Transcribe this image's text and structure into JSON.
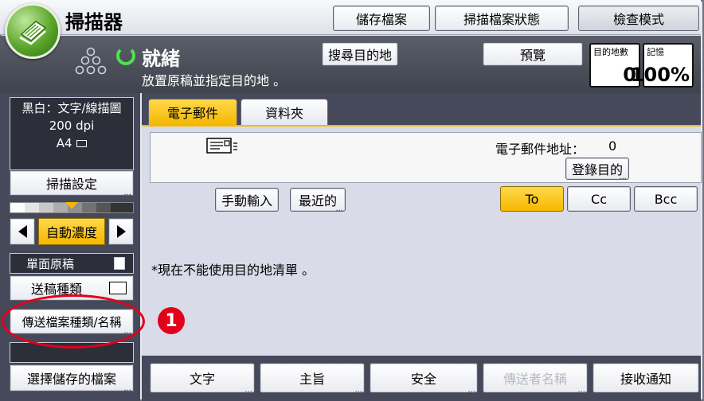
{
  "app": {
    "title": "掃描器"
  },
  "header_buttons": {
    "store_file": "儲存檔案",
    "scanned_files_status": "掃描檔案狀態",
    "check_mode": "檢查模式"
  },
  "status": {
    "title": "就緒",
    "message": "放置原稿並指定目的地 。",
    "search_destination": "搜尋目的地",
    "preview": "預覽"
  },
  "counters": {
    "destinations_label": "目的地數",
    "destinations_value": "0",
    "memory_label": "記憶",
    "memory_value": "100%"
  },
  "sidebar": {
    "info_lines": [
      "黑白：文字/線描圖",
      "200 dpi",
      "A4"
    ],
    "scan_settings": "掃描設定",
    "density_label": "自動濃度",
    "original_type": "單面原稿",
    "feed_type": "送稿種類",
    "file_type_name": "傳送檔案種類/名稱",
    "select_stored_file": "選擇儲存的檔案"
  },
  "tabs": [
    {
      "label": "電子郵件"
    },
    {
      "label": "資料夾"
    }
  ],
  "email": {
    "address_label": "電子郵件地址：",
    "address_count": "0",
    "register_destination": "登錄目的",
    "manual_input": "手動輸入",
    "recent": "最近的",
    "to": "To",
    "cc": "Cc",
    "bcc": "Bcc",
    "note": "*現在不能使用目的地清單 。"
  },
  "bottom_buttons": {
    "text": "文字",
    "subject": "主旨",
    "security": "安全",
    "sender_name": "傳送者名稱",
    "reception_notice": "接收通知"
  },
  "annotation": {
    "number": "1"
  },
  "colors": {
    "accent_yellow": "#f5b800",
    "annotation_red": "#e3001b",
    "status_green": "#4fe04f"
  }
}
